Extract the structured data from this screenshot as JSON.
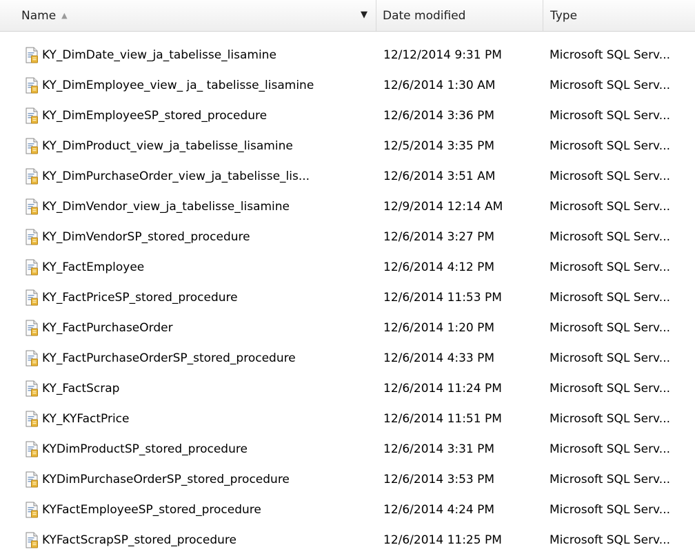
{
  "header": {
    "name_label": "Name",
    "sort_icon": "sort-ascending-icon",
    "dropdown_icon": "chevron-down-icon",
    "date_label": "Date modified",
    "type_label": "Type"
  },
  "files": [
    {
      "name": "KY_DimDate_view_ja_tabelisse_lisamine",
      "date": "12/12/2014 9:31 PM",
      "type": "Microsoft SQL Serv..."
    },
    {
      "name": "KY_DimEmployee_view_ ja_ tabelisse_lisamine",
      "date": "12/6/2014 1:30 AM",
      "type": "Microsoft SQL Serv..."
    },
    {
      "name": "KY_DimEmployeeSP_stored_procedure",
      "date": "12/6/2014 3:36 PM",
      "type": "Microsoft SQL Serv..."
    },
    {
      "name": "KY_DimProduct_view_ja_tabelisse_lisamine",
      "date": "12/5/2014 3:35 PM",
      "type": "Microsoft SQL Serv..."
    },
    {
      "name": "KY_DimPurchaseOrder_view_ja_tabelisse_lis...",
      "date": "12/6/2014 3:51 AM",
      "type": "Microsoft SQL Serv..."
    },
    {
      "name": "KY_DimVendor_view_ja_tabelisse_lisamine",
      "date": "12/9/2014 12:14 AM",
      "type": "Microsoft SQL Serv..."
    },
    {
      "name": "KY_DimVendorSP_stored_procedure",
      "date": "12/6/2014 3:27 PM",
      "type": "Microsoft SQL Serv..."
    },
    {
      "name": "KY_FactEmployee",
      "date": "12/6/2014 4:12 PM",
      "type": "Microsoft SQL Serv..."
    },
    {
      "name": "KY_FactPriceSP_stored_procedure",
      "date": "12/6/2014 11:53 PM",
      "type": "Microsoft SQL Serv..."
    },
    {
      "name": "KY_FactPurchaseOrder",
      "date": "12/6/2014 1:20 PM",
      "type": "Microsoft SQL Serv..."
    },
    {
      "name": "KY_FactPurchaseOrderSP_stored_procedure",
      "date": "12/6/2014 4:33 PM",
      "type": "Microsoft SQL Serv..."
    },
    {
      "name": "KY_FactScrap",
      "date": "12/6/2014 11:24 PM",
      "type": "Microsoft SQL Serv..."
    },
    {
      "name": "KY_KYFactPrice",
      "date": "12/6/2014 11:51 PM",
      "type": "Microsoft SQL Serv..."
    },
    {
      "name": "KYDimProductSP_stored_procedure",
      "date": "12/6/2014 3:31 PM",
      "type": "Microsoft SQL Serv..."
    },
    {
      "name": "KYDimPurchaseOrderSP_stored_procedure",
      "date": "12/6/2014 3:53 PM",
      "type": "Microsoft SQL Serv..."
    },
    {
      "name": "KYFactEmployeeSP_stored_procedure",
      "date": "12/6/2014 4:24 PM",
      "type": "Microsoft SQL Serv..."
    },
    {
      "name": "KYFactScrapSP_stored_procedure",
      "date": "12/6/2014 11:25 PM",
      "type": "Microsoft SQL Serv..."
    }
  ],
  "file_icon": "sql-file-icon"
}
